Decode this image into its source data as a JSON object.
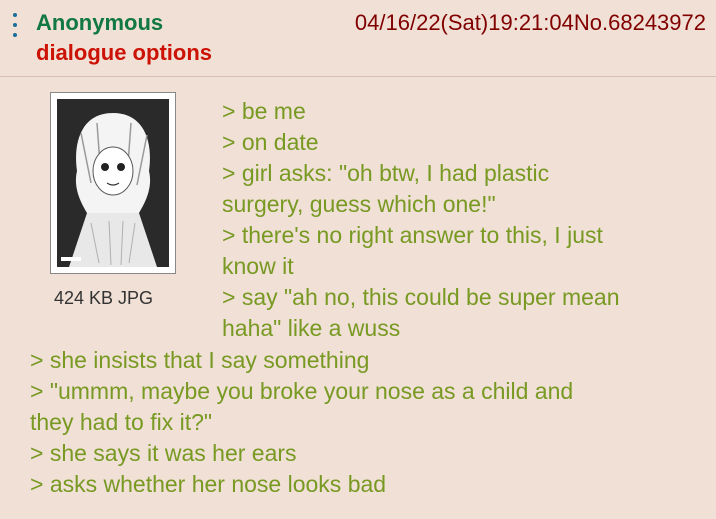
{
  "post": {
    "name": "Anonymous",
    "subject": "dialogue options",
    "datetime": "04/16/22(Sat)19:21:04",
    "number": "No.68243972",
    "file": {
      "info": "424 KB JPG",
      "thumbnail_icon": "manga-girl-thumbnail"
    },
    "lines": [
      "> be me",
      "> on date",
      "> girl asks: \"oh btw, I had plastic",
      "surgery, guess which one!\"",
      "> there's no right answer to this, I just",
      "know it",
      "> say \"ah no, this could be super mean",
      "haha\" like a wuss",
      "> she insists that I say something",
      "> \"ummm, maybe you broke your nose as a child and",
      "they had to fix it?\"",
      "> she says it was her ears",
      "> asks whether her nose looks bad"
    ]
  },
  "colors": {
    "background": "#f0e0d6",
    "name": "#117743",
    "subject": "#cc1105",
    "greentext": "#789922",
    "meta": "#800000"
  }
}
